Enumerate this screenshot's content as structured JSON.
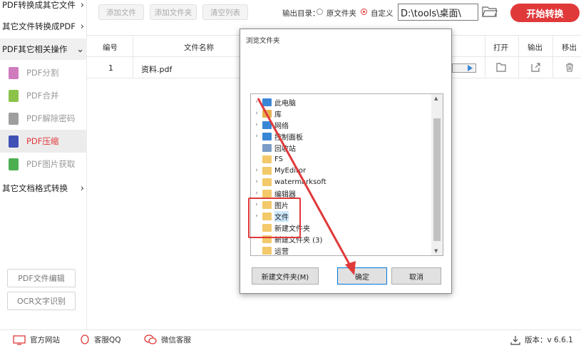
{
  "sidebar": {
    "categories": [
      {
        "label": "PDF转换成其它文件",
        "expanded": false
      },
      {
        "label": "其它文件转换成PDF",
        "expanded": false
      },
      {
        "label": "PDF其它相关操作",
        "expanded": true
      },
      {
        "label": "其它文档格式转换",
        "expanded": false
      }
    ],
    "items": [
      {
        "label": "PDF分割",
        "icon": "pdf-split-icon",
        "color": "#d07bbd"
      },
      {
        "label": "PDF合并",
        "icon": "pdf-merge-icon",
        "color": "#8bc34a"
      },
      {
        "label": "PDF解除密码",
        "icon": "pdf-unlock-icon",
        "color": "#9e9e9e"
      },
      {
        "label": "PDF压缩",
        "icon": "pdf-compress-icon",
        "color": "#3f51b5",
        "active": true
      },
      {
        "label": "PDF图片获取",
        "icon": "pdf-image-icon",
        "color": "#4caf50"
      }
    ],
    "bottom_buttons": [
      "PDF文件编辑",
      "OCR文字识别"
    ]
  },
  "toolbar": {
    "add_file": "添加文件",
    "add_folder": "添加文件夹",
    "clear_list": "清空列表",
    "output_label": "输出目录：",
    "option_original": "原文件夹",
    "option_custom": "自定义",
    "selected_option": "自定义",
    "path": "D:\\tools\\桌面\\",
    "start": "开始转换",
    "accent": "#e0393a"
  },
  "table": {
    "headers": {
      "index": "编号",
      "filename": "文件名称",
      "open": "打开",
      "output": "输出",
      "remove": "移出"
    },
    "rows": [
      {
        "index": "1",
        "filename": "资料.pdf"
      }
    ]
  },
  "dialog": {
    "title": "浏览文件夹",
    "tree": [
      {
        "label": "此电脑",
        "icon": "computer-icon",
        "expandable": true
      },
      {
        "label": "库",
        "icon": "library-icon",
        "expandable": true
      },
      {
        "label": "网络",
        "icon": "network-icon",
        "expandable": true
      },
      {
        "label": "控制面板",
        "icon": "control-panel-icon",
        "expandable": true
      },
      {
        "label": "回收站",
        "icon": "recycle-bin-icon",
        "expandable": false
      },
      {
        "label": "FS",
        "icon": "folder-icon",
        "expandable": false
      },
      {
        "label": "MyEditor",
        "icon": "folder-icon",
        "expandable": true
      },
      {
        "label": "watermarksoft",
        "icon": "folder-icon",
        "expandable": true
      },
      {
        "label": "编辑器",
        "icon": "folder-icon",
        "expandable": true
      },
      {
        "label": "图片",
        "icon": "folder-icon",
        "expandable": true
      },
      {
        "label": "文件",
        "icon": "folder-icon",
        "expandable": true,
        "selected": true
      },
      {
        "label": "新建文件夹",
        "icon": "folder-icon",
        "expandable": false
      },
      {
        "label": "新建文件夹 (3)",
        "icon": "folder-icon",
        "expandable": false
      },
      {
        "label": "运营",
        "icon": "folder-icon",
        "expandable": false
      }
    ],
    "new_folder": "新建文件夹(M)",
    "ok": "确定",
    "cancel": "取消"
  },
  "footer": {
    "website": "官方网站",
    "qq": "客服QQ",
    "wechat": "微信客服",
    "version": "版本：v 6.6.1"
  }
}
